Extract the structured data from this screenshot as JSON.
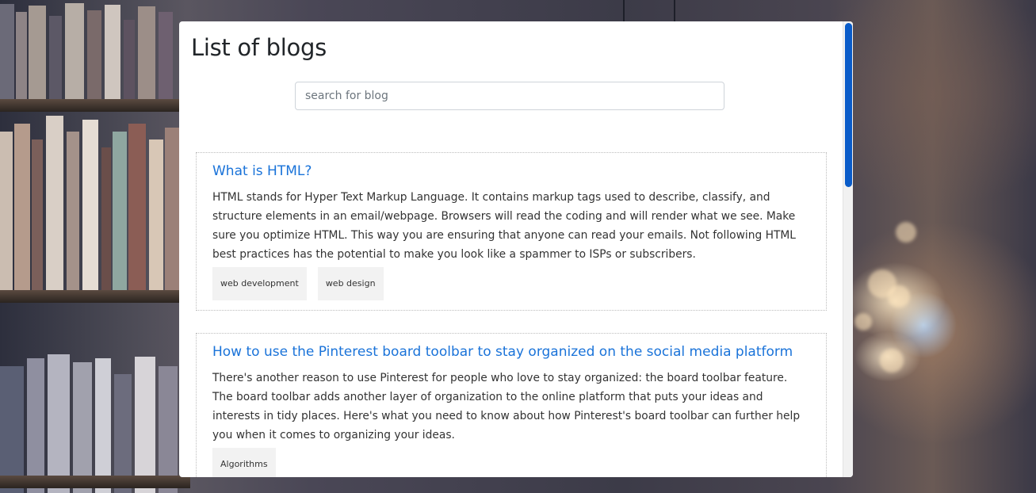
{
  "page": {
    "title": "List of blogs"
  },
  "search": {
    "placeholder": "search for blog",
    "value": ""
  },
  "blogs": [
    {
      "title": "What is HTML?",
      "body": "HTML stands for Hyper Text Markup Language. It contains markup tags used to describe, classify, and structure elements in an email/webpage. Browsers will read the coding and will render what we see. Make sure you optimize HTML. This way you are ensuring that anyone can read your emails. Not following HTML best practices has the potential to make you look like a spammer to ISPs or subscribers.",
      "tags": [
        "web development",
        "web design"
      ]
    },
    {
      "title": "How to use the Pinterest board toolbar to stay organized on the social media platform",
      "body": "There's another reason to use Pinterest for people who love to stay organized: the board toolbar feature. The board toolbar adds another layer of organization to the online platform that puts your ideas and interests in tidy places. Here's what you need to know about how Pinterest's board toolbar can further help you when it comes to organizing your ideas.",
      "tags": [
        "Algorithms"
      ]
    }
  ],
  "colors": {
    "link": "#1a73d9",
    "scroll_thumb": "#0a5cc9",
    "panel": "#ffffff"
  }
}
